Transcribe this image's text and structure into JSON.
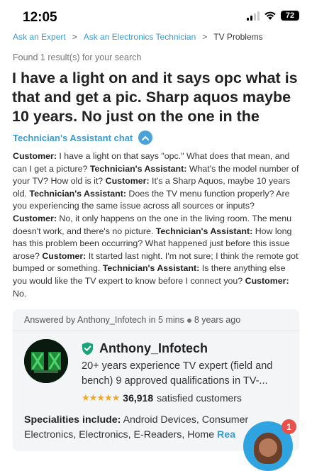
{
  "status": {
    "time": "12:05",
    "battery": "72"
  },
  "breadcrumb": {
    "items": [
      "Ask an Expert",
      "Ask an Electronics Technician",
      "TV Problems"
    ],
    "separator": ">"
  },
  "results_text": "Found 1 result(s) for your search",
  "question_title": "I have a light on and it says opc what is that and get a pic. Sharp aquos maybe 10 years. No just on the one in the",
  "assistant_chat_label": "Technician's Assistant chat",
  "transcript": [
    {
      "speaker": "Customer:",
      "text": " I have a light on that says \"opc.\" What does that mean, and can I get a picture? "
    },
    {
      "speaker": "Technician's Assistant:",
      "text": " What's the model number of your TV? How old is it? "
    },
    {
      "speaker": "Customer:",
      "text": " It's a Sharp Aquos, maybe 10 years old. "
    },
    {
      "speaker": "Technician's Assistant:",
      "text": " Does the TV menu function properly? Are you experiencing the same issue across all sources or inputs? "
    },
    {
      "speaker": "Customer:",
      "text": " No, it only happens on the one in the living room. The menu doesn't work, and there's no picture. "
    },
    {
      "speaker": "Technician's Assistant:",
      "text": " How long has this problem been occurring? What happened just before this issue arose? "
    },
    {
      "speaker": "Customer:",
      "text": " It started last night. I'm not sure; I think the remote got bumped or something. "
    },
    {
      "speaker": "Technician's Assistant:",
      "text": " Is there anything else you would like the TV expert to know before I connect you? "
    },
    {
      "speaker": "Customer:",
      "text": " No."
    }
  ],
  "answer": {
    "answered_by": "Answered by Anthony_Infotech in 5 mins",
    "time_ago": "8 years ago",
    "expert_name": "Anthony_Infotech",
    "bio": "20+ years experience TV expert (field and bench) 9 approved qualifications in TV-...",
    "stars": "★★★★★",
    "rating_count": "36,918",
    "rating_text": "satisfied customers",
    "specialities_label": "Specialities include:",
    "specialities": " Android Devices, Consumer Electronics, Electronics, E-Readers, Home ",
    "read_more": "Rea"
  },
  "chat_widget": {
    "badge_count": "1"
  },
  "colors": {
    "link": "#3a9bd0",
    "accent": "#2fa4e0",
    "badge": "#e8504a",
    "stars": "#f5a623",
    "verified": "#1aa37a"
  }
}
